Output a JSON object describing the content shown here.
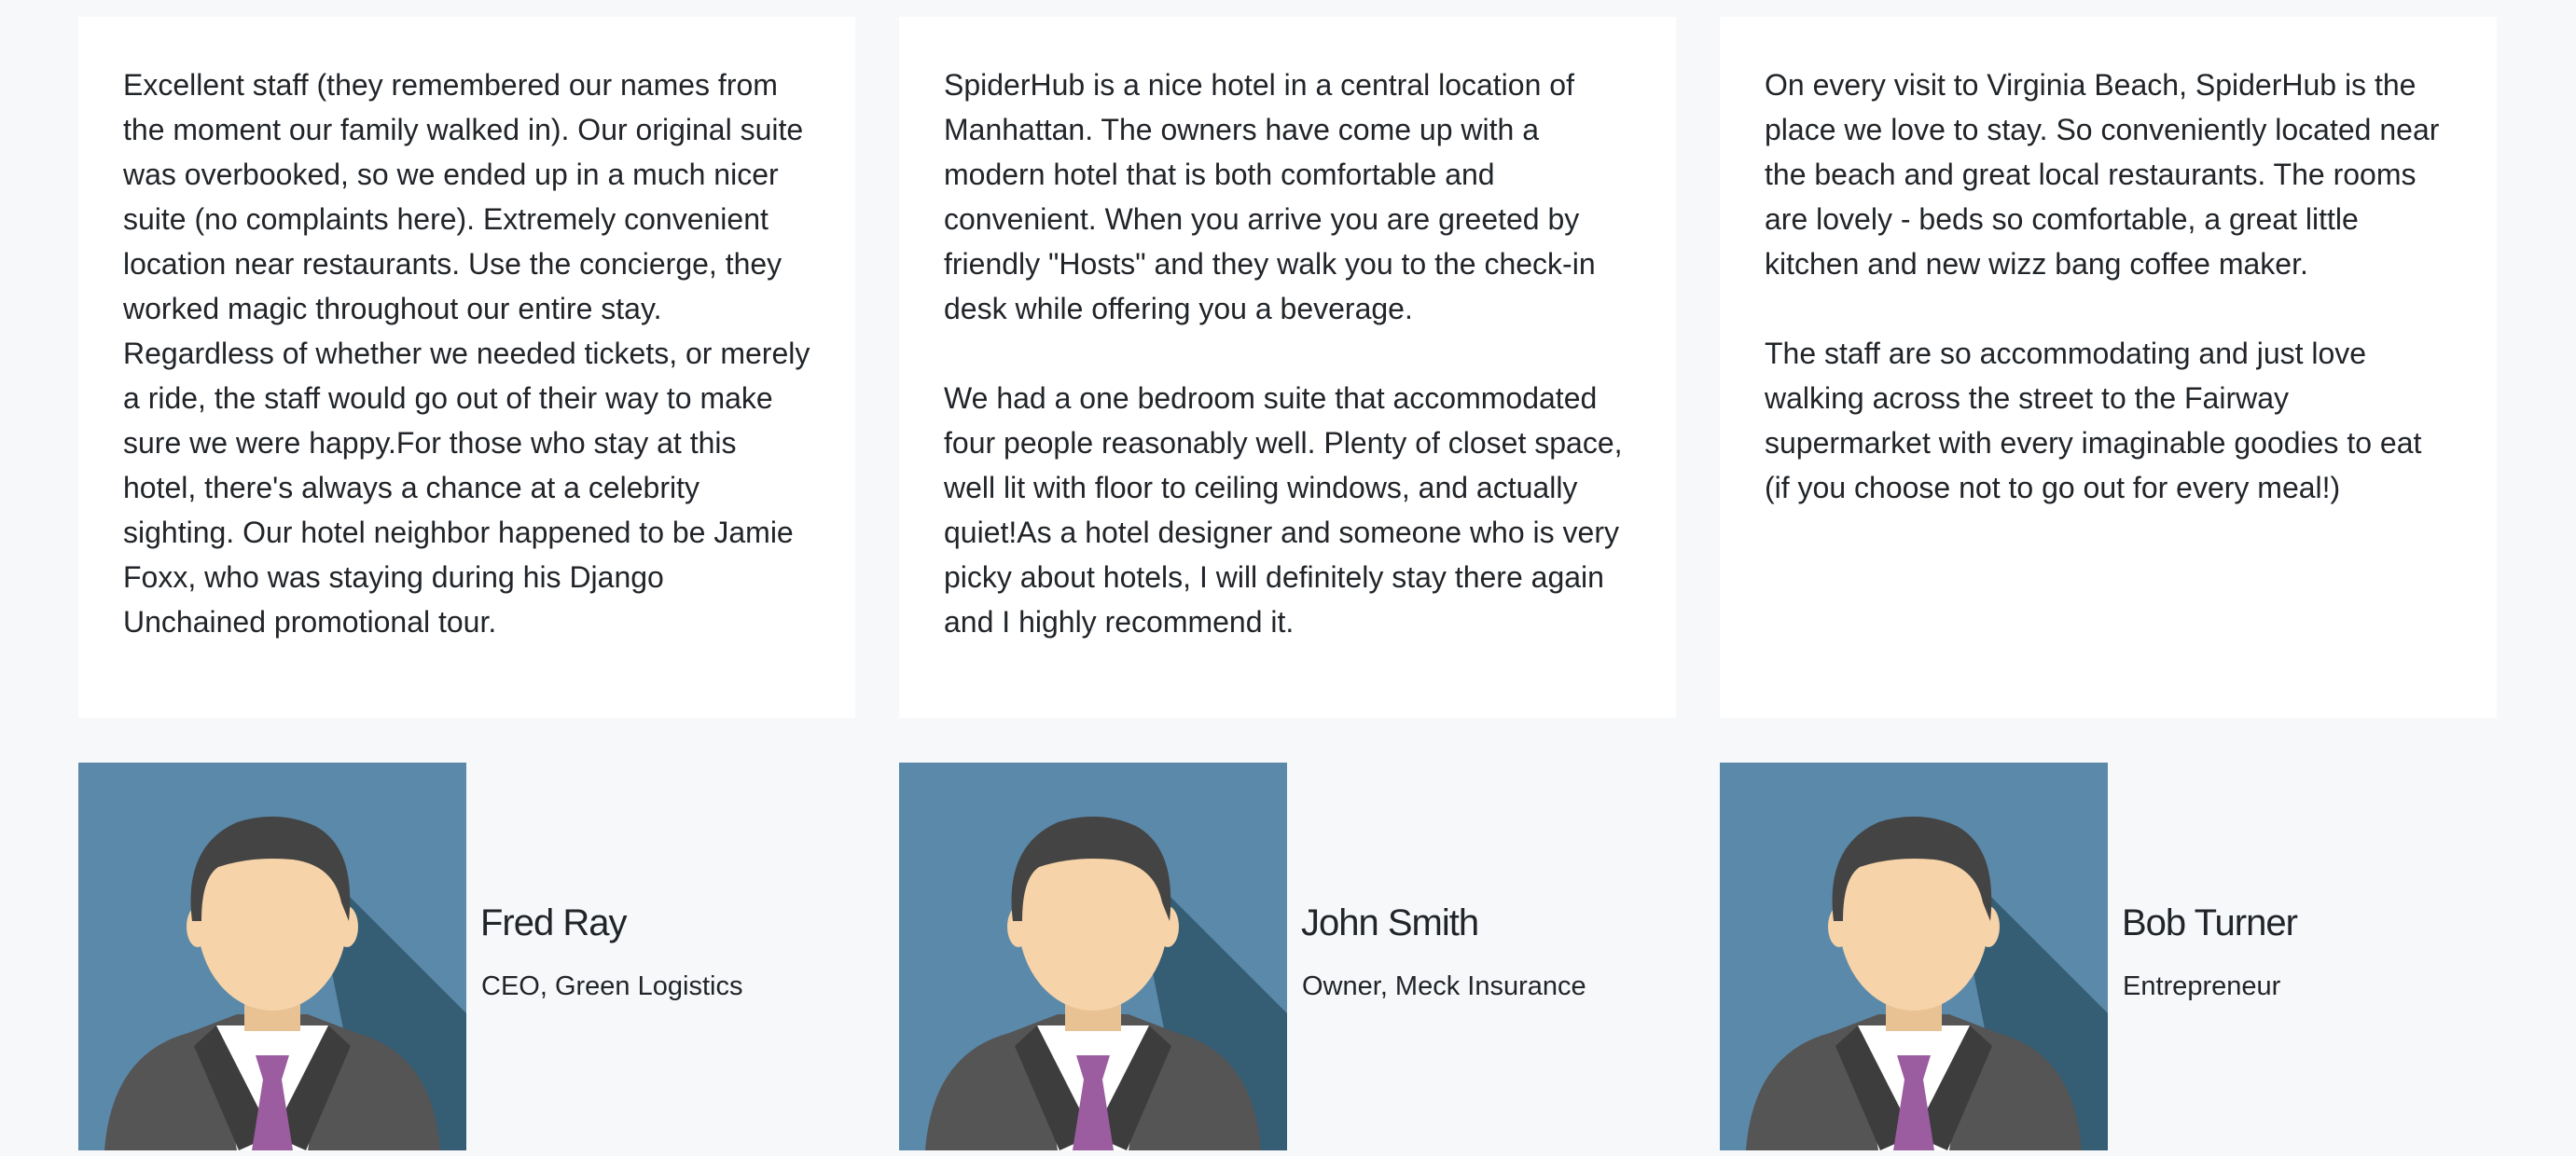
{
  "testimonials": [
    {
      "quote": "Excellent staff (they remembered our names from the moment our family walked in). Our original suite was overbooked, so we ended up in a much nicer suite (no complaints here). Extremely convenient location near restaurants. Use the concierge, they worked magic throughout our entire stay. Regardless of whether we needed tickets, or merely a ride, the staff would go out of their way to make sure we were happy.For those who stay at this hotel, there's always a chance at a celebrity sighting. Our hotel neighbor happened to be Jamie Foxx, who was staying during his Django Unchained promotional tour.",
      "author_name": "Fred Ray",
      "author_role": "CEO, Green Logistics",
      "avatar_icon": "businessman-avatar-icon"
    },
    {
      "quote": "SpiderHub is a nice hotel in a central location of Manhattan. The owners have come up with a modern hotel that is both comfortable and convenient. When you arrive you are greeted by friendly \"Hosts\" and they walk you to the check-in desk while offering you a beverage.\n\nWe had a one bedroom suite that accommodated four people reasonably well. Plenty of closet space, well lit with floor to ceiling windows, and actually quiet!As a hotel designer and someone who is very picky about hotels, I will definitely stay there again and I highly recommend it.",
      "author_name": "John Smith",
      "author_role": "Owner, Meck Insurance",
      "avatar_icon": "businessman-avatar-icon"
    },
    {
      "quote": "On every visit to Virginia Beach, SpiderHub is the place we love to stay. So conveniently located near the beach and great local restaurants. The rooms are lovely - beds so comfortable, a great little kitchen and new wizz bang coffee maker.\n\nThe staff are so accommodating and just love walking across the street to the Fairway supermarket with every imaginable goodies to eat (if you choose not to go out for every meal!)",
      "author_name": "Bob Turner",
      "author_role": "Entrepreneur",
      "avatar_icon": "businessman-avatar-icon"
    }
  ],
  "colors": {
    "page_background": "#f7f8fa",
    "card_background": "#ffffff",
    "text": "#212529",
    "avatar_background": "#5b89aa",
    "avatar_shadow": "#355d74",
    "avatar_hair": "#444444",
    "avatar_skin": "#f6d3a8",
    "avatar_suit": "#555555",
    "avatar_tie": "#9b5ca0"
  }
}
